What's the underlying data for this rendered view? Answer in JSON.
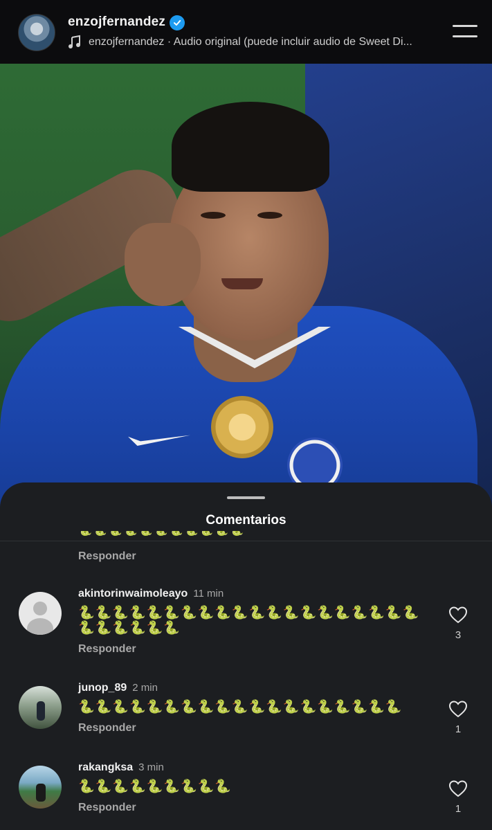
{
  "header": {
    "username": "enzojfernandez",
    "audio_text": "enzojfernandez · Audio original (puede incluir audio de Sweet Di..."
  },
  "sheet": {
    "title": "Comentarios",
    "partial_text": "🐍🐍🐍🐍🐍🐍🐍🐍🐍🐍🐍",
    "partial_reply": "Responder"
  },
  "comments": [
    {
      "user": "akintorinwaimoleayo",
      "time": "11 min",
      "text": "🐍🐍🐍🐍🐍🐍🐍🐍🐍🐍🐍🐍🐍🐍🐍🐍🐍🐍🐍🐍🐍🐍🐍🐍🐍🐍",
      "reply": "Responder",
      "likes": "3"
    },
    {
      "user": "junop_89",
      "time": "2 min",
      "text": "🐍🐍🐍🐍🐍🐍🐍🐍🐍🐍🐍🐍🐍🐍🐍🐍🐍🐍🐍",
      "reply": "Responder",
      "likes": "1"
    },
    {
      "user": "rakangksa",
      "time": "3 min",
      "text": "🐍🐍🐍🐍🐍🐍🐍🐍🐍",
      "reply": "Responder",
      "likes": "1"
    }
  ],
  "colors": {
    "header_bg": "#0c0c0e",
    "sheet_bg": "#1c1e21",
    "verified": "#1d9bf0"
  }
}
